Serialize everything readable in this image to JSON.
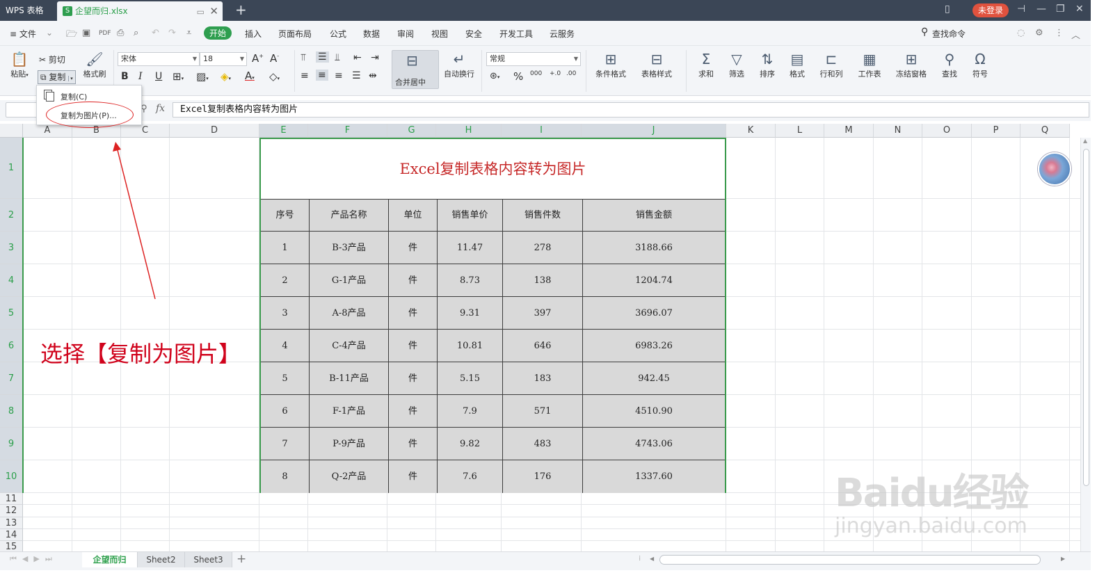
{
  "titlebar": {
    "app": "WPS 表格",
    "file_tab": "企望而归.xlsx",
    "new_tab": "+",
    "login": "未登录"
  },
  "menubar": {
    "file": "≡ 文件",
    "items": [
      "开始",
      "插入",
      "页面布局",
      "公式",
      "数据",
      "审阅",
      "视图",
      "安全",
      "开发工具",
      "云服务"
    ],
    "search": "查找命令"
  },
  "ribbon": {
    "paste": "粘贴",
    "cut": "剪切",
    "copy": "复制",
    "format_painter": "格式刷",
    "font_name": "宋体",
    "font_size": "18",
    "merge_center": "合并居中",
    "wrap_text": "自动换行",
    "number_format": "常规",
    "cond_format": "条件格式",
    "table_style": "表格样式",
    "sum": "求和",
    "filter": "筛选",
    "sort": "排序",
    "format": "格式",
    "row_col": "行和列",
    "worksheet": "工作表",
    "freeze": "冻结窗格",
    "find": "查找",
    "symbol": "符号"
  },
  "copy_menu": {
    "copy_item": "复制(C)",
    "copy_as_picture": "复制为图片(P)..."
  },
  "formula_bar": {
    "fx": "fx",
    "content": "Excel复制表格内容转为图片"
  },
  "columns": [
    "A",
    "B",
    "C",
    "D",
    "E",
    "F",
    "G",
    "H",
    "I",
    "J",
    "K",
    "L",
    "M",
    "N",
    "O",
    "P",
    "Q"
  ],
  "rows": [
    "1",
    "2",
    "3",
    "4",
    "5",
    "6",
    "7",
    "8",
    "9",
    "10",
    "11",
    "12",
    "13",
    "14",
    "15"
  ],
  "table": {
    "title": "Excel复制表格内容转为图片",
    "headers": [
      "序号",
      "产品名称",
      "单位",
      "销售单价",
      "销售件数",
      "销售金额"
    ],
    "rows": [
      [
        "1",
        "B-3产品",
        "件",
        "11.47",
        "278",
        "3188.66"
      ],
      [
        "2",
        "G-1产品",
        "件",
        "8.73",
        "138",
        "1204.74"
      ],
      [
        "3",
        "A-8产品",
        "件",
        "9.31",
        "397",
        "3696.07"
      ],
      [
        "4",
        "C-4产品",
        "件",
        "10.81",
        "646",
        "6983.26"
      ],
      [
        "5",
        "B-11产品",
        "件",
        "5.15",
        "183",
        "942.45"
      ],
      [
        "6",
        "F-1产品",
        "件",
        "7.9",
        "571",
        "4510.90"
      ],
      [
        "7",
        "P-9产品",
        "件",
        "9.82",
        "483",
        "4743.06"
      ],
      [
        "8",
        "Q-2产品",
        "件",
        "7.6",
        "176",
        "1337.60"
      ]
    ]
  },
  "annotation": "选择【复制为图片】",
  "sheets": [
    "企望而归",
    "Sheet2",
    "Sheet3"
  ],
  "watermark": {
    "brand": "Baidu经验",
    "url": "jingyan.baidu.com"
  },
  "colors": {
    "accent_green": "#2e9e4f",
    "annotation_red": "#d0021b",
    "title_red": "#c62828",
    "login_red": "#e0523e"
  }
}
